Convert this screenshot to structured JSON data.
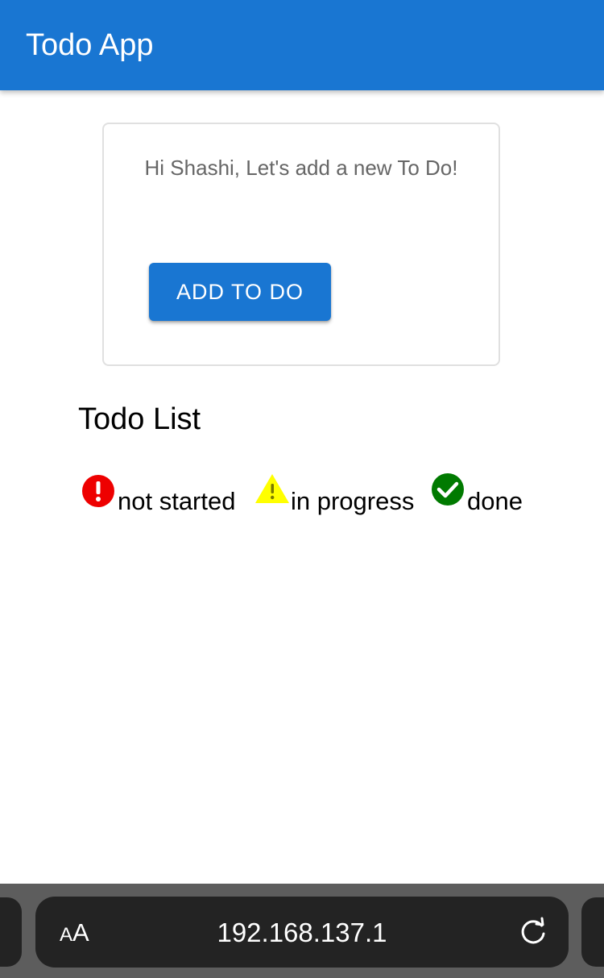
{
  "app_bar": {
    "title": "Todo App",
    "background_color": "#1976d2"
  },
  "card": {
    "greeting": "Hi Shashi, Let's add a new To Do!",
    "add_button_label": "ADD TO DO"
  },
  "todo_list": {
    "heading": "Todo List",
    "legend": [
      {
        "icon": "error-icon",
        "label": "not started",
        "color": "#ee0000"
      },
      {
        "icon": "warning-icon",
        "label": "in progress",
        "color": "#ffff00"
      },
      {
        "icon": "check-circle-icon",
        "label": "done",
        "color": "#007a00"
      }
    ]
  },
  "browser": {
    "text_size_label_small": "A",
    "text_size_label_large": "A",
    "url": "192.168.137.1",
    "reload_icon": "reload-icon"
  }
}
